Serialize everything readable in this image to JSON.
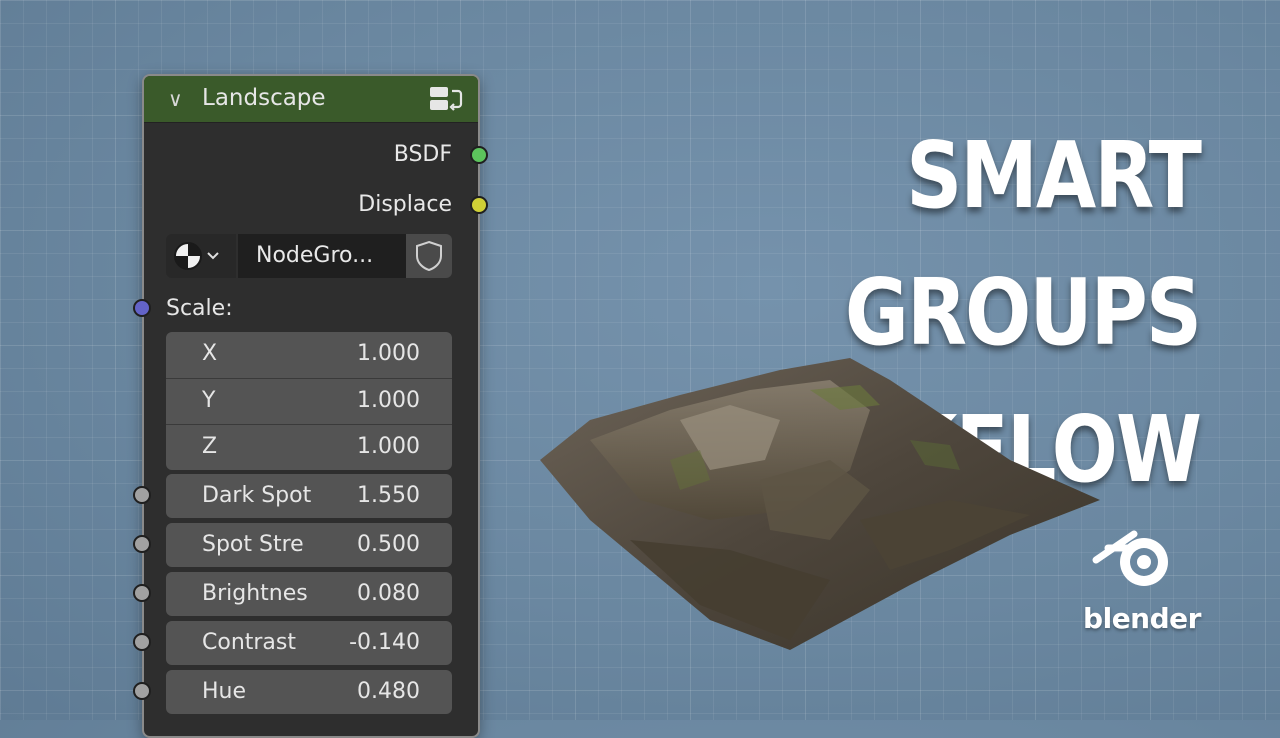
{
  "node": {
    "title": "Landscape",
    "outputs": [
      {
        "label": "BSDF",
        "color": "#5cc35c"
      },
      {
        "label": "Displace",
        "color": "#cfcf36"
      }
    ],
    "datablock_name": "NodeGro...",
    "scale_label": "Scale:",
    "scale_socket_color": "#6363c7",
    "scale": [
      {
        "axis": "X",
        "value": "1.000"
      },
      {
        "axis": "Y",
        "value": "1.000"
      },
      {
        "axis": "Z",
        "value": "1.000"
      }
    ],
    "inputs": [
      {
        "label": "Dark Spot",
        "value": "1.550"
      },
      {
        "label": "Spot Stre",
        "value": "0.500"
      },
      {
        "label": "Brightnes",
        "value": "0.080"
      },
      {
        "label": "Contrast",
        "value": "-0.140"
      },
      {
        "label": "Hue",
        "value": "0.480"
      }
    ],
    "input_socket_color": "#a1a1a1",
    "header_color": "#3a5a2a"
  },
  "headline": {
    "line1": "SMART GROUPS",
    "line2": "WORKFLOW"
  },
  "brand": {
    "wordmark": "blender"
  }
}
